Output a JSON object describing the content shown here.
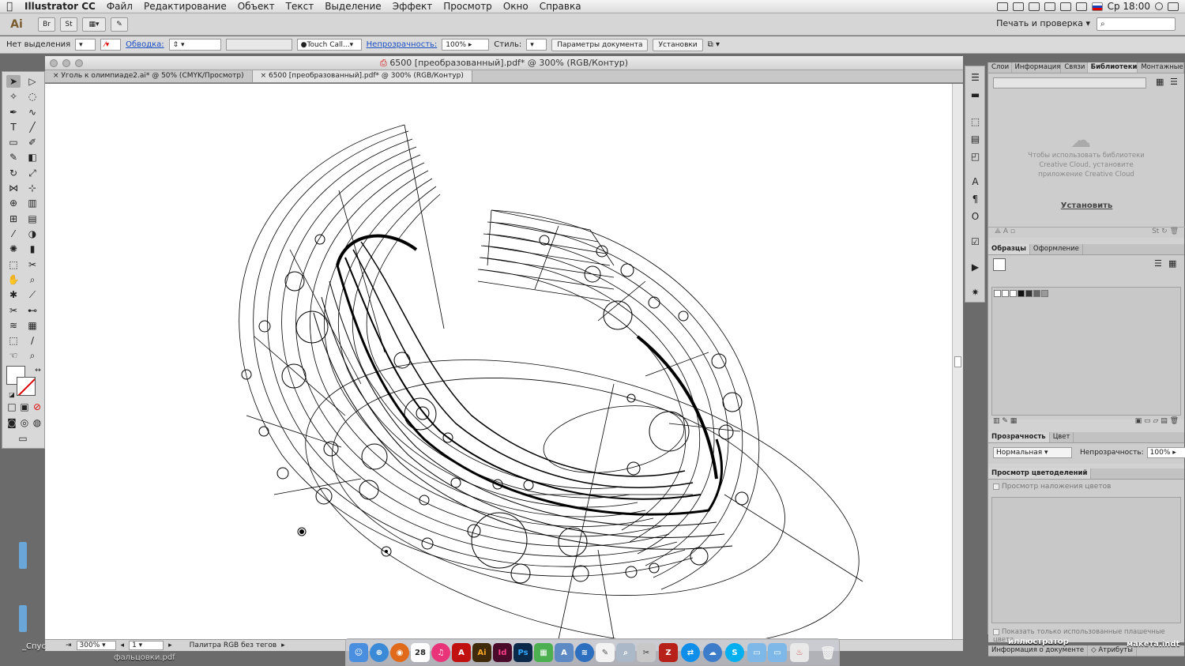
{
  "menubar": {
    "items": [
      "Illustrator CC",
      "Файл",
      "Редактирование",
      "Объект",
      "Текст",
      "Выделение",
      "Эффект",
      "Просмотр",
      "Окно",
      "Справка"
    ],
    "clock": "Ср 18:00"
  },
  "appbar": {
    "logo": "Ai",
    "btn1": "Br",
    "btn2": "St",
    "workspace": "Печать и проверка",
    "search_placeholder": ""
  },
  "controlbar": {
    "selection": "Нет выделения",
    "stroke_label": "Обводка:",
    "brush": "Touch Call...",
    "opacity_label": "Непрозрачность:",
    "opacity_value": "100%",
    "style_label": "Стиль:",
    "doc_setup": "Параметры документа",
    "preferences": "Установки"
  },
  "document": {
    "title": "6500 [преобразованный].pdf* @ 300% (RGB/Контур)",
    "tabs": [
      "Уголь к олимпиаде2.ai* @ 50% (CMYK/Просмотр)",
      "6500 [преобразованный].pdf* @ 300% (RGB/Контур)"
    ],
    "zoom": "300%",
    "artboard": "1",
    "status": "Палитра RGB без тегов"
  },
  "panels": {
    "top_tabs": [
      "Слои",
      "Информация",
      "Связи",
      "Библиотеки",
      "Монтажные"
    ],
    "library_msg": "Чтобы использовать библиотеки Creative Cloud, установите приложение Creative Cloud",
    "library_link": "Установить",
    "swatch_tabs": [
      "Образцы",
      "Оформление"
    ],
    "transparency_tabs": [
      "Прозрачность",
      "Цвет"
    ],
    "blend_mode": "Нормальная",
    "opacity_label": "Непрозрачность:",
    "opacity_value": "100%",
    "separations_title": "Просмотр цветоделений",
    "overprint": "Просмотр наложения цветов",
    "spot_only": "Показать только использованные плашечные цвета",
    "bottom_tabs": [
      "Информация о документе",
      "Атрибуты"
    ]
  },
  "desktop": {
    "label1": "иллюстратор",
    "label2": "макета.indt",
    "label3": "фальцовки.pdf",
    "label4": "_Спус"
  },
  "dock": {
    "apps": [
      "Finder",
      "Safari",
      "Firefox",
      "Calendar",
      "iTunes",
      "Acrobat",
      "Illustrator",
      "InDesign",
      "Photoshop",
      "Maps",
      "Preview",
      "Bridge",
      "TextEdit",
      "Network",
      "Migrate",
      "FileZilla",
      "TeamViewer",
      "Skype",
      "Folder1",
      "Folder2",
      "Java",
      "Trash"
    ],
    "calendar_day": "28"
  },
  "colors": {
    "dock_ai": "#3f2b0a",
    "dock_id": "#4a0a2a",
    "dock_ps": "#0b2a4a",
    "dock_acrobat": "#c01010",
    "dock_filezilla": "#b8201a"
  }
}
